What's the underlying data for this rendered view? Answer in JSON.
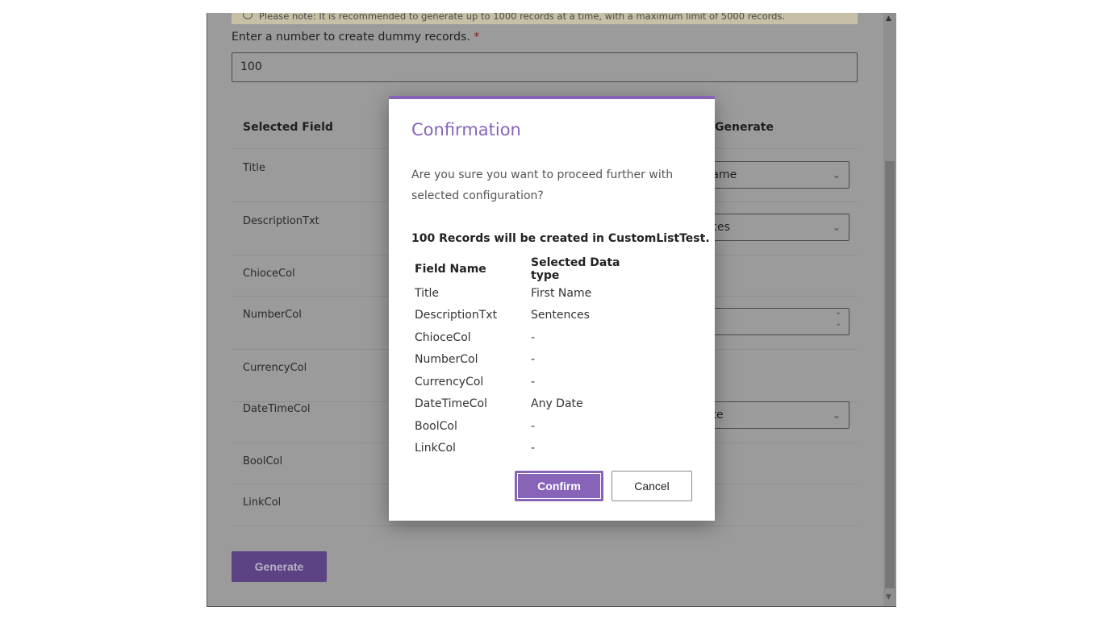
{
  "form": {
    "banner_text": "Please note: It is recommended to generate up to 1000 records at a time, with a maximum limit of 5000 records.",
    "records_label": "Enter a number to create dummy records.",
    "required_mark": "*",
    "records_value": "100",
    "col_selected_field": "Selected Field",
    "col_generate": "Generate",
    "fields": [
      "Title",
      "DescriptionTxt",
      "ChioceCol",
      "NumberCol",
      "CurrencyCol",
      "DateTimeCol",
      "BoolCol",
      "LinkCol"
    ],
    "dropdowns": {
      "title": "First Name",
      "description": "Sentences",
      "datetime": "Any Date"
    },
    "generate_label": "Generate"
  },
  "dialog": {
    "title": "Confirmation",
    "message": "Are you sure you want to proceed further with selected configuration?",
    "summary": "100 Records will be created in CustomListTest.",
    "headers": [
      "Field Name",
      "Selected Data type"
    ],
    "rows": [
      [
        "Title",
        "First Name"
      ],
      [
        "DescriptionTxt",
        "Sentences"
      ],
      [
        "ChioceCol",
        "-"
      ],
      [
        "NumberCol",
        "-"
      ],
      [
        "CurrencyCol",
        "-"
      ],
      [
        "DateTimeCol",
        "Any Date"
      ],
      [
        "BoolCol",
        "-"
      ],
      [
        "LinkCol",
        "-"
      ]
    ],
    "confirm_label": "Confirm",
    "cancel_label": "Cancel"
  },
  "colors": {
    "accent": "#8764b8",
    "overlay": "#9b9b9b"
  }
}
